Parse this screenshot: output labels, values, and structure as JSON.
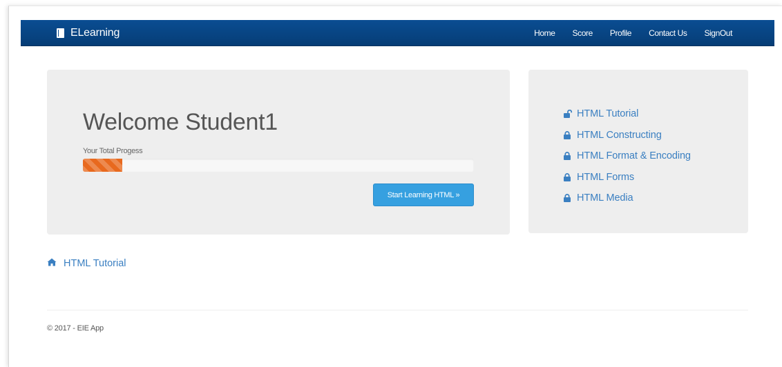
{
  "brand": {
    "name": "ELearning",
    "icon": "book-icon"
  },
  "nav": {
    "items": [
      {
        "label": "Home"
      },
      {
        "label": "Score"
      },
      {
        "label": "Profile"
      },
      {
        "label": "Contact Us"
      },
      {
        "label": "SignOut"
      }
    ]
  },
  "welcome": {
    "heading": "Welcome Student1",
    "progress_label": "Your Total Progess",
    "progress_fraction": 0.1,
    "start_button": "Start Learning HTML »"
  },
  "lessons": [
    {
      "label": "HTML Tutorial",
      "icon": "unlock-icon",
      "locked": false
    },
    {
      "label": "HTML Constructing",
      "icon": "lock-icon",
      "locked": true
    },
    {
      "label": "HTML Format & Encoding",
      "icon": "lock-icon",
      "locked": true
    },
    {
      "label": "HTML Forms",
      "icon": "lock-icon",
      "locked": true
    },
    {
      "label": "HTML Media",
      "icon": "lock-icon",
      "locked": true
    }
  ],
  "breadcrumb": {
    "icon": "home-icon",
    "label": "HTML Tutorial"
  },
  "footer": {
    "text": "© 2017 - EIE App"
  },
  "colors": {
    "navbar": "#0a4d92",
    "link": "#3a7fc1",
    "progress": "#e8691e",
    "button": "#36a0e0",
    "panel": "#eeeeee"
  }
}
